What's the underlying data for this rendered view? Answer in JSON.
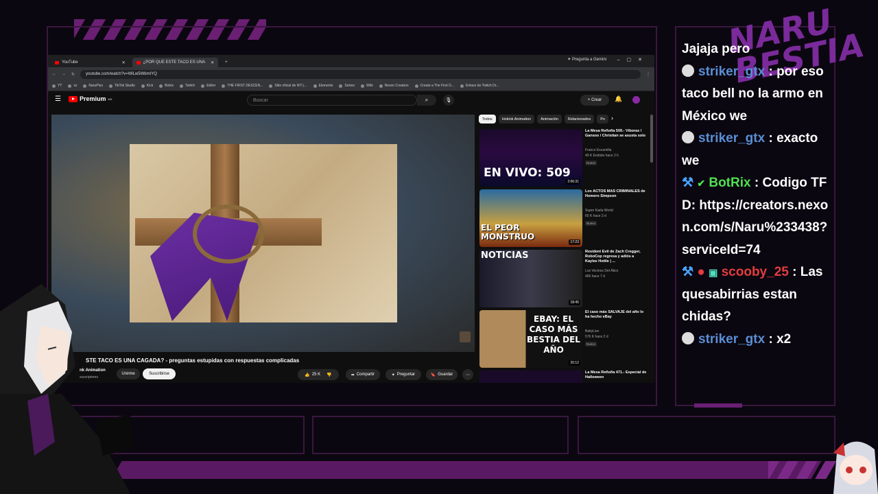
{
  "browser": {
    "tabs": [
      {
        "label": "YouTube"
      },
      {
        "label": "¿POR QUE ESTE TACO ES UNA"
      }
    ],
    "new_tab": "+",
    "gemini_label": "Pregunta a Gemini",
    "url": "youtube.com/watch?v=WlLw5WbmIYQ",
    "bookmarks": [
      "YT",
      "xx",
      "NaruPlus",
      "TikTok Studio",
      "Kick",
      "Botrix",
      "Twitch",
      "Editor",
      "THE FIRST DESCEN...",
      "Sitio oficial de NTI |...",
      "Elements",
      "Sorteo",
      "Wiki",
      "Nexon Creators",
      "Create a The First D...",
      "Enlace de Twitch Dr..."
    ]
  },
  "youtube": {
    "logo": "Premium",
    "logo_badge": "MX",
    "search_placeholder": "Buscar",
    "create_label": "Crear",
    "video_title": "STE TACO ES UNA CAGADA? - preguntas estupidas con respuestas complicadas",
    "channel": "nk Animation",
    "subscribers": "suscriptores",
    "join_label": "Unirme",
    "subscribe_label": "Suscribirse",
    "likes": "25 K",
    "share_label": "Compartir",
    "ask_label": "Preguntar",
    "save_label": "Guardar",
    "chips": [
      "Todos",
      "Hokink Animation",
      "Animación",
      "Relacionados",
      "Po"
    ],
    "recommendations": [
      {
        "title": "La Mesa Reñoña 509.- Víboras / Gansos / Christian se asusta solo",
        "channel": "Franco Escamilla",
        "meta": "49 K  Emitido hace 2 h",
        "badge": "Nuevo",
        "duration": "2:06:31",
        "thumb_text": "EN VIVO: 509"
      },
      {
        "title": "Los ACTOS MAS CRIMINALES de Homero Simpson",
        "channel": "Super Karla World",
        "meta": "65 K  hace 3 d",
        "badge": "Nuevo",
        "duration": "17:23",
        "thumb_text": "EL PEOR MONSTRUO"
      },
      {
        "title": "Resident Evil de Zach Cregger, RoboCop regresa y adiós a Kaylee Hottle | ...",
        "channel": "Los Vecinos Del Ático",
        "meta": "466  hace 7 d",
        "badge": "",
        "duration": "18:45",
        "thumb_text": "NOTICIAS"
      },
      {
        "title": "El caso más SALVAJE del año lo ha hecho eBay",
        "channel": "BaityLive",
        "meta": "576 K  hace 2 d",
        "badge": "Nuevo",
        "duration": "20:12",
        "thumb_text": "EBAY: EL CASO MÁS BESTIA DEL AÑO"
      },
      {
        "title": "La Mesa Reñoña 471.- Especial de Halloween",
        "channel": "",
        "meta": "",
        "badge": "",
        "duration": "",
        "thumb_text": ""
      }
    ]
  },
  "chat": [
    {
      "user": "",
      "sep": "",
      "text": "Jajaja pero"
    },
    {
      "user": "striker_gtx",
      "sep": " : ",
      "text": "por eso taco bell no la armo en México we"
    },
    {
      "user": "striker_gtx",
      "sep": " : ",
      "text": "exacto we"
    },
    {
      "user": "BotRix",
      "sep": " : ",
      "text": "Codigo TFD: https://creators.nexon.com/s/Naru%233438?serviceId=74"
    },
    {
      "user": "scooby_25",
      "sep": " : ",
      "text": "Las quesabirrias estan chidas?"
    },
    {
      "user": "striker_gtx",
      "sep": " : ",
      "text": "x2"
    }
  ],
  "overlay_logo": "NARU BESTIA",
  "colors": {
    "accent": "#6a1f73",
    "chat_user": "#5a8fd6",
    "bot": "#4fe04f",
    "scooby": "#e23d3d"
  }
}
